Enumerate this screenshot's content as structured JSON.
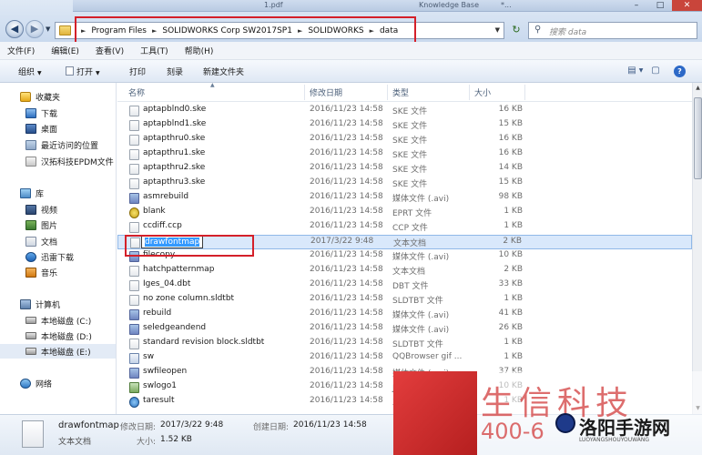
{
  "titlebar": {
    "ghost_tabs": [
      "1.pdf",
      "Knowledge Base",
      "*..."
    ]
  },
  "address": {
    "crumbs": [
      "Program Files",
      "SOLIDWORKS Corp SW2017SP1",
      "SOLIDWORKS",
      "data"
    ],
    "search_placeholder": "搜索 data"
  },
  "menu": [
    "文件(F)",
    "编辑(E)",
    "查看(V)",
    "工具(T)",
    "帮助(H)"
  ],
  "toolbar": {
    "organize": "组织",
    "open": "打开",
    "print": "打印",
    "burn": "刻录",
    "new_folder": "新建文件夹"
  },
  "nav": {
    "favorites": {
      "label": "收藏夹",
      "items": [
        "下载",
        "桌面",
        "最近访问的位置",
        "汉拓科技EPDM文件"
      ]
    },
    "libraries": {
      "label": "库",
      "items": [
        "视频",
        "图片",
        "文档",
        "迅雷下载",
        "音乐"
      ]
    },
    "computer": {
      "label": "计算机",
      "items": [
        "本地磁盘 (C:)",
        "本地磁盘 (D:)",
        "本地磁盘 (E:)"
      ]
    },
    "network": {
      "label": "网络"
    }
  },
  "columns": {
    "name": "名称",
    "date": "修改日期",
    "type": "类型",
    "size": "大小"
  },
  "files": [
    {
      "name": "aptapblnd0.ske",
      "date": "2016/11/23 14:58",
      "type": "SKE 文件",
      "size": "16 KB",
      "icon": "file"
    },
    {
      "name": "aptapblnd1.ske",
      "date": "2016/11/23 14:58",
      "type": "SKE 文件",
      "size": "15 KB",
      "icon": "file"
    },
    {
      "name": "aptapthru0.ske",
      "date": "2016/11/23 14:58",
      "type": "SKE 文件",
      "size": "16 KB",
      "icon": "file"
    },
    {
      "name": "aptapthru1.ske",
      "date": "2016/11/23 14:58",
      "type": "SKE 文件",
      "size": "16 KB",
      "icon": "file"
    },
    {
      "name": "aptapthru2.ske",
      "date": "2016/11/23 14:58",
      "type": "SKE 文件",
      "size": "14 KB",
      "icon": "file"
    },
    {
      "name": "aptapthru3.ske",
      "date": "2016/11/23 14:58",
      "type": "SKE 文件",
      "size": "15 KB",
      "icon": "file"
    },
    {
      "name": "asmrebuild",
      "date": "2016/11/23 14:58",
      "type": "媒体文件 (.avi)",
      "size": "98 KB",
      "icon": "media"
    },
    {
      "name": "blank",
      "date": "2016/11/23 14:58",
      "type": "EPRT 文件",
      "size": "1 KB",
      "icon": "eprt"
    },
    {
      "name": "ccdiff.ccp",
      "date": "2016/11/23 14:58",
      "type": "CCP 文件",
      "size": "1 KB",
      "icon": "file"
    },
    {
      "name": "drawfontmap",
      "date": "2017/3/22 9:48",
      "type": "文本文档",
      "size": "2 KB",
      "icon": "file",
      "selected": true
    },
    {
      "name": "filecopy",
      "date": "2016/11/23 14:58",
      "type": "媒体文件 (.avi)",
      "size": "10 KB",
      "icon": "media"
    },
    {
      "name": "hatchpatternmap",
      "date": "2016/11/23 14:58",
      "type": "文本文档",
      "size": "2 KB",
      "icon": "file"
    },
    {
      "name": "Iges_04.dbt",
      "date": "2016/11/23 14:58",
      "type": "DBT 文件",
      "size": "33 KB",
      "icon": "file"
    },
    {
      "name": "no zone column.sldtbt",
      "date": "2016/11/23 14:58",
      "type": "SLDTBT 文件",
      "size": "1 KB",
      "icon": "file"
    },
    {
      "name": "rebuild",
      "date": "2016/11/23 14:58",
      "type": "媒体文件 (.avi)",
      "size": "41 KB",
      "icon": "media"
    },
    {
      "name": "seledgeandend",
      "date": "2016/11/23 14:58",
      "type": "媒体文件 (.avi)",
      "size": "26 KB",
      "icon": "media"
    },
    {
      "name": "standard revision block.sldtbt",
      "date": "2016/11/23 14:58",
      "type": "SLDTBT 文件",
      "size": "1 KB",
      "icon": "file"
    },
    {
      "name": "sw",
      "date": "2016/11/23 14:58",
      "type": "QQBrowser gif ...",
      "size": "1 KB",
      "icon": "qq"
    },
    {
      "name": "swfileopen",
      "date": "2016/11/23 14:58",
      "type": "媒体文件 (.avi)",
      "size": "37 KB",
      "icon": "media"
    },
    {
      "name": "swlogo1",
      "date": "2016/11/23 14:58",
      "type": "JPEG 图像",
      "size": "10 KB",
      "icon": "jpeg"
    },
    {
      "name": "taresult",
      "date": "2016/11/23 14:58",
      "type": "XSL 文件",
      "size": "1 KB",
      "icon": "xsl"
    }
  ],
  "details": {
    "name": "drawfontmap",
    "type": "文本文档",
    "modified_label": "修改日期:",
    "modified": "2017/3/22 9:48",
    "created_label": "创建日期:",
    "created": "2016/11/23 14:58",
    "size_label": "大小:",
    "size": "1.52 KB"
  },
  "watermark": {
    "big": "生信科技",
    "phone": "400-6",
    "brand": "洛阳手游网",
    "url": "LUOYANGSHOUYOUWANG"
  },
  "colors": {
    "highlight": "#d4202a",
    "selection": "#d9e8fb",
    "accent": "#3399ff"
  }
}
